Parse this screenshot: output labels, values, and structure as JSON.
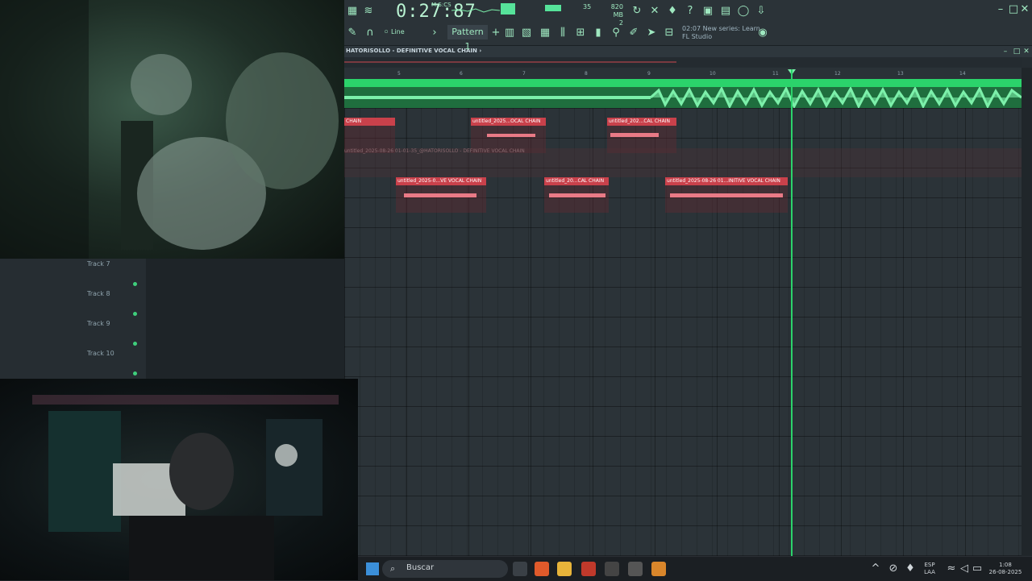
{
  "toolbar": {
    "time": "0:27:87",
    "time_unit": "M:S:CS",
    "cpu_value": "35",
    "memory": "820 MB",
    "polyphony": "2",
    "snap_mode": "Line",
    "pattern": "Pattern 1",
    "hint_line1": "02:07 New series: Learn",
    "hint_line2": "FL Studio"
  },
  "playlist": {
    "title": "HATORISOLLO - DEFINITIVE VOCAL CHAIN",
    "bar_numbers": [
      "5",
      "6",
      "7",
      "8",
      "9",
      "10",
      "11",
      "12",
      "13",
      "14"
    ],
    "ghost_label": "untitled_2025-08-26 01-01-35_@HATORISOLLO - DEFINITIVE VOCAL CHAIN",
    "clips_row1": [
      "CHAIN",
      "untitled_2025...OCAL CHAIN",
      "untitled_202...CAL CHAIN"
    ],
    "clips_row2": [
      "untitled_2025-0...VE VOCAL CHAIN",
      "untitled_20...CAL CHAIN",
      "untitled_2025-08-26 01...INITIVE VOCAL CHAIN"
    ],
    "tracks": [
      "Track 7",
      "Track 8",
      "Track 9",
      "Track 10"
    ]
  },
  "taskbar": {
    "search_placeholder": "Buscar",
    "lang_line1": "ESP",
    "lang_line2": "LAA",
    "clock_time": "1:08",
    "clock_date": "26-08-2025"
  },
  "colors": {
    "accent_green": "#2bd36b",
    "clip_red": "#c9414b",
    "waveform_green": "#7cf0aa"
  }
}
